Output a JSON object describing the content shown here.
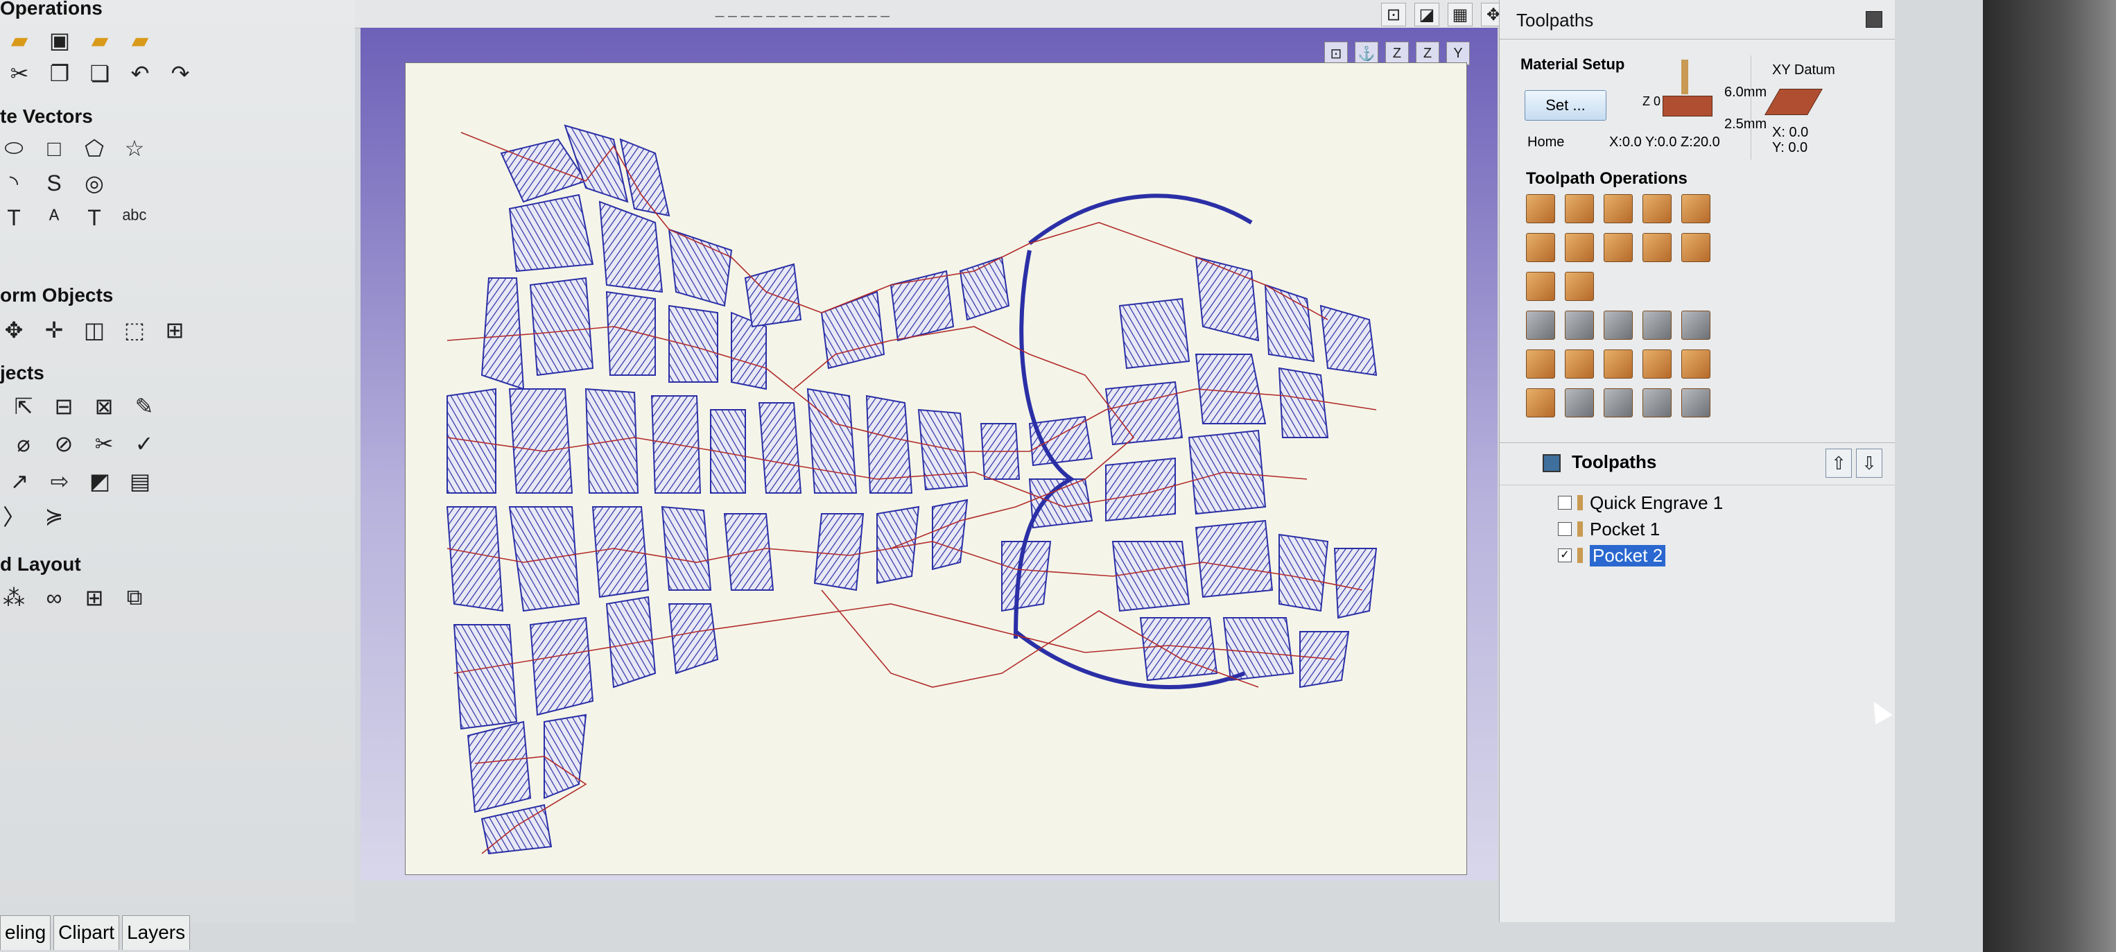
{
  "left_panel": {
    "sections": [
      {
        "title": "Operations"
      },
      {
        "title": "te Vectors"
      },
      {
        "title": "orm Objects"
      },
      {
        "title": "jects"
      },
      {
        "title": "d Layout"
      }
    ],
    "bottom_tabs": [
      "eling",
      "Clipart",
      "Layers"
    ]
  },
  "toolbar": {
    "title": "_ _ _ _ _ _ _ _ _ _ _ _ _ _"
  },
  "right_panel": {
    "header_title": "Toolpaths",
    "material_setup": {
      "title": "Material Setup",
      "set_label": "Set ...",
      "z_label": "Z 0",
      "thickness_top": "6.0mm",
      "thickness_bottom": "2.5mm",
      "home_label": "Home",
      "home_coords": "X:0.0 Y:0.0 Z:20.0"
    },
    "xy_datum": {
      "title": "XY Datum",
      "x": "X: 0.0",
      "y": "Y: 0.0"
    },
    "toolpath_operations_title": "Toolpath Operations",
    "toolpaths_title": "Toolpaths",
    "toolpaths": [
      {
        "label": "Quick Engrave 1",
        "checked": false,
        "selected": false
      },
      {
        "label": "Pocket 1",
        "checked": false,
        "selected": false
      },
      {
        "label": "Pocket 2",
        "checked": true,
        "selected": true
      }
    ]
  },
  "colors": {
    "viewport_top": "#6d60b8",
    "viewport_bottom": "#d8d7ea",
    "sheet": "#f4f5e8",
    "toolpath_blue": "#2b2fa6",
    "toolpath_red": "#b22b2b",
    "selection": "#2a68d0"
  }
}
